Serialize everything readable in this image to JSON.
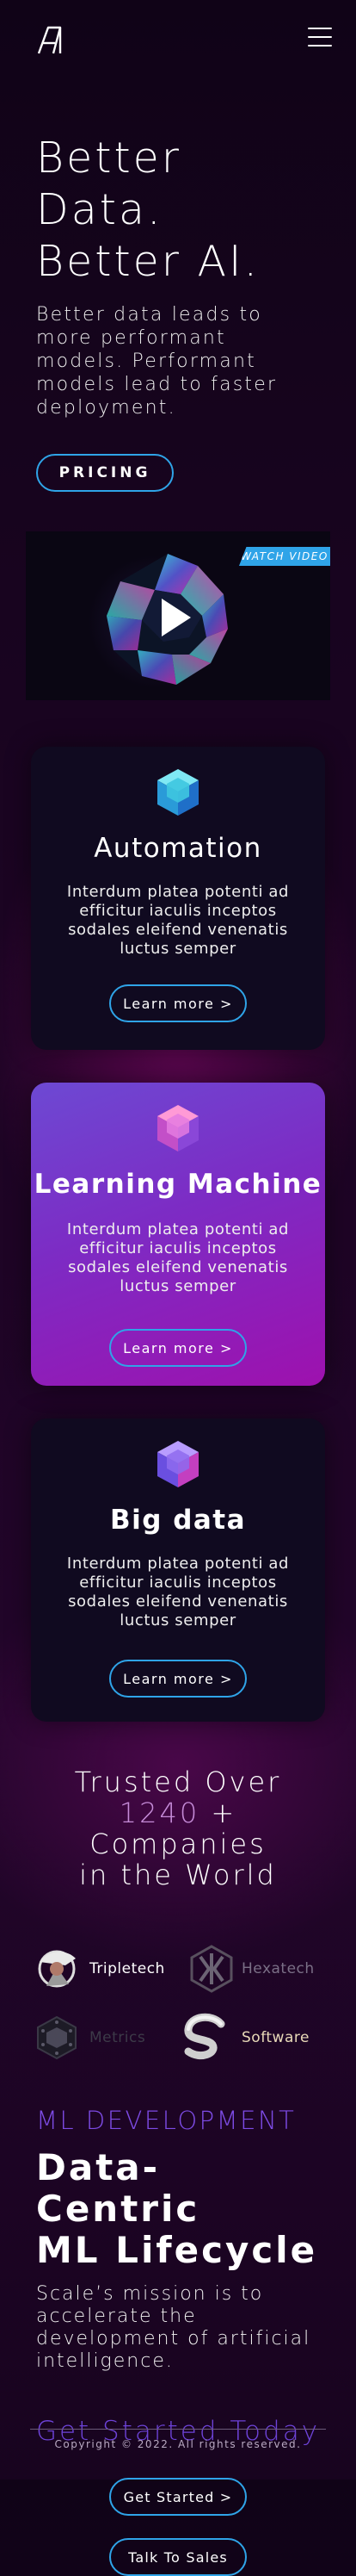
{
  "header": {
    "logo_icon": "ai-logo-icon",
    "menu_icon": "hamburger-menu-icon"
  },
  "hero": {
    "title_line1": "Better Data.",
    "title_line2": "Better AI.",
    "subtitle": "Better data leads to more performant models. Performant models lead to faster deployment.",
    "pricing_label": "PRICING"
  },
  "video": {
    "badge": "WATCH VIDEO",
    "play_icon": "play-icon"
  },
  "cards": [
    {
      "title": "Automation",
      "body": "Interdum platea potenti ad efficitur iaculis inceptos sodales eleifend venenatis luctus semper",
      "button": "Learn more >",
      "icon": "cube-icon"
    },
    {
      "title": "Learning Machine",
      "body": "Interdum platea potenti ad efficitur iaculis inceptos sodales eleifend venenatis luctus semper",
      "button": "Learn more >",
      "icon": "cube-icon"
    },
    {
      "title": "Big data",
      "body": "Interdum platea potenti ad efficitur iaculis inceptos sodales eleifend venenatis luctus semper",
      "button": "Learn more >",
      "icon": "cube-icon"
    }
  ],
  "trusted": {
    "line1": "Trusted Over",
    "count": "1240",
    "line2_rest": " + Companies",
    "line3": "in the World"
  },
  "partners": [
    {
      "name": "Tripletech",
      "icon": "tripletech-logo-icon",
      "color": "#ffffff"
    },
    {
      "name": "Hexatech",
      "icon": "hexatech-logo-icon",
      "color": "#7a6f86"
    },
    {
      "name": "Metrics",
      "icon": "metrics-logo-icon",
      "color": "#3c3a48"
    },
    {
      "name": "Software",
      "icon": "software-logo-icon",
      "color": "#e8d9b8"
    }
  ],
  "ml": {
    "tag": "ML DEVELOPMENT",
    "title_line1": "Data-Centric",
    "title_line2": "ML Lifecycle",
    "body": "Scale’s mission is to accelerate the development of artificial intelligence."
  },
  "cta": {
    "title": "Get Started Today",
    "get_started": "Get Started >",
    "talk_sales": "Talk To Sales"
  },
  "footer": {
    "copyright": "Copyright © 2022. All rights reserved."
  },
  "colors": {
    "accent_blue": "#2fa4e8",
    "accent_purple": "#7d4be5",
    "background": "#1d0424"
  }
}
